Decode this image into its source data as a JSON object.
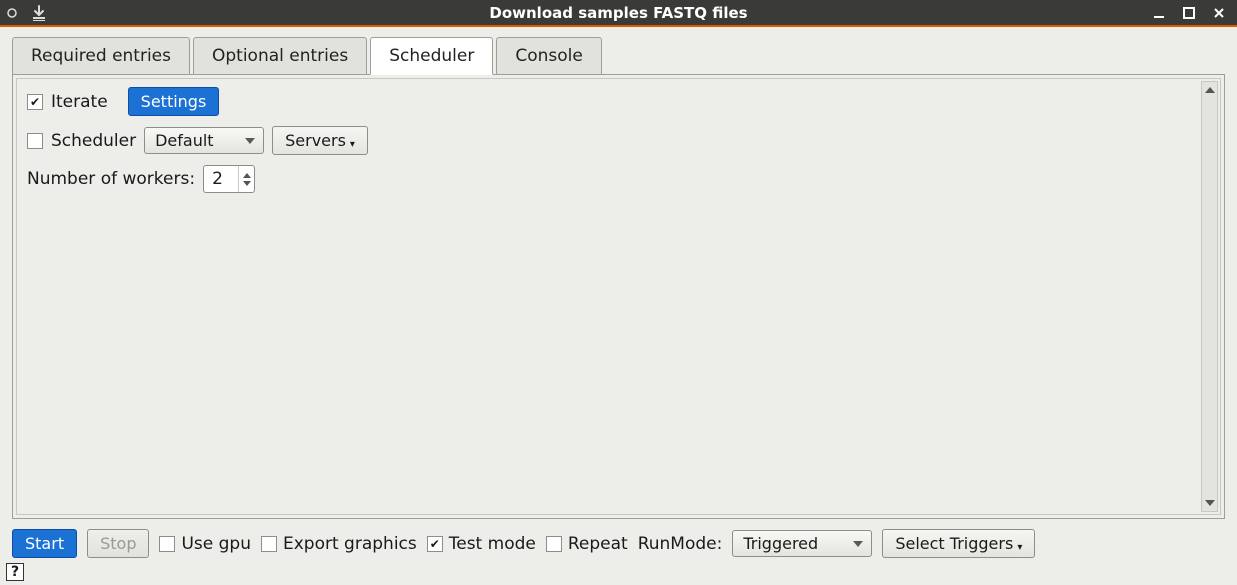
{
  "titlebar": {
    "title": "Download samples FASTQ files"
  },
  "tabs": [
    {
      "label": "Required entries",
      "active": false
    },
    {
      "label": "Optional entries",
      "active": false
    },
    {
      "label": "Scheduler",
      "active": true
    },
    {
      "label": "Console",
      "active": false
    }
  ],
  "scheduler": {
    "iterate_label": "Iterate",
    "iterate_checked": true,
    "settings_button": "Settings",
    "scheduler_label": "Scheduler",
    "scheduler_checked": false,
    "scheduler_select_value": "Default",
    "servers_button": "Servers",
    "workers_label": "Number of workers:",
    "workers_value": "2"
  },
  "bottom": {
    "start": "Start",
    "stop": "Stop",
    "use_gpu_label": "Use gpu",
    "use_gpu_checked": false,
    "export_graphics_label": "Export graphics",
    "export_graphics_checked": false,
    "test_mode_label": "Test mode",
    "test_mode_checked": true,
    "repeat_label": "Repeat",
    "repeat_checked": false,
    "runmode_label": "RunMode:",
    "runmode_value": "Triggered",
    "select_triggers": "Select Triggers"
  },
  "help": {
    "symbol": "?"
  }
}
